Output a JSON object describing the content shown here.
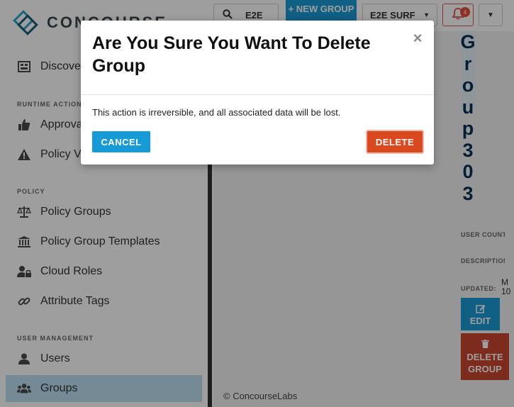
{
  "app": {
    "logo_text": "CONCOURSE",
    "search": {
      "value": "E2E"
    },
    "new_group_button": "+ NEW GROUP",
    "tenant_select": "E2E SURF",
    "notifications_count": "4"
  },
  "sidebar": {
    "top_items": [
      {
        "label": "Discover",
        "icon": "discover-icon"
      }
    ],
    "sections": [
      {
        "label": "RUNTIME ACTIONS",
        "items": [
          {
            "label": "Approvals",
            "icon": "thumbs-up-icon"
          },
          {
            "label": "Policy Violations",
            "icon": "warning-icon"
          }
        ]
      },
      {
        "label": "POLICY",
        "items": [
          {
            "label": "Policy Groups",
            "icon": "scale-icon"
          },
          {
            "label": "Policy Group Templates",
            "icon": "bank-icon"
          },
          {
            "label": "Cloud Roles",
            "icon": "user-lock-icon"
          },
          {
            "label": "Attribute Tags",
            "icon": "link-icon"
          }
        ]
      },
      {
        "label": "USER MANAGEMENT",
        "items": [
          {
            "label": "Users",
            "icon": "user-icon"
          },
          {
            "label": "Groups",
            "icon": "users-icon",
            "active": true
          }
        ]
      }
    ]
  },
  "group_detail": {
    "group_name": "Group303",
    "user_count_label": "USER COUNT:",
    "description_label": "DESCRIPTION:",
    "updated_label": "UPDATED:",
    "updated_value": "M 10",
    "edit_button": "EDIT",
    "delete_button": "DELETE GROUP"
  },
  "footer": {
    "text": "© ConcourseLabs"
  },
  "modal": {
    "title": "Are You Sure You Want To Delete Group",
    "body": "This action is irreversible, and all associated data will be lost.",
    "cancel_button": "CANCEL",
    "delete_button": "DELETE",
    "close_symbol": "×"
  },
  "colors": {
    "primary": "#1a9ad6",
    "danger": "#d9481f",
    "active_nav": "#bcdff0",
    "title_navy": "#0b2f5b"
  }
}
